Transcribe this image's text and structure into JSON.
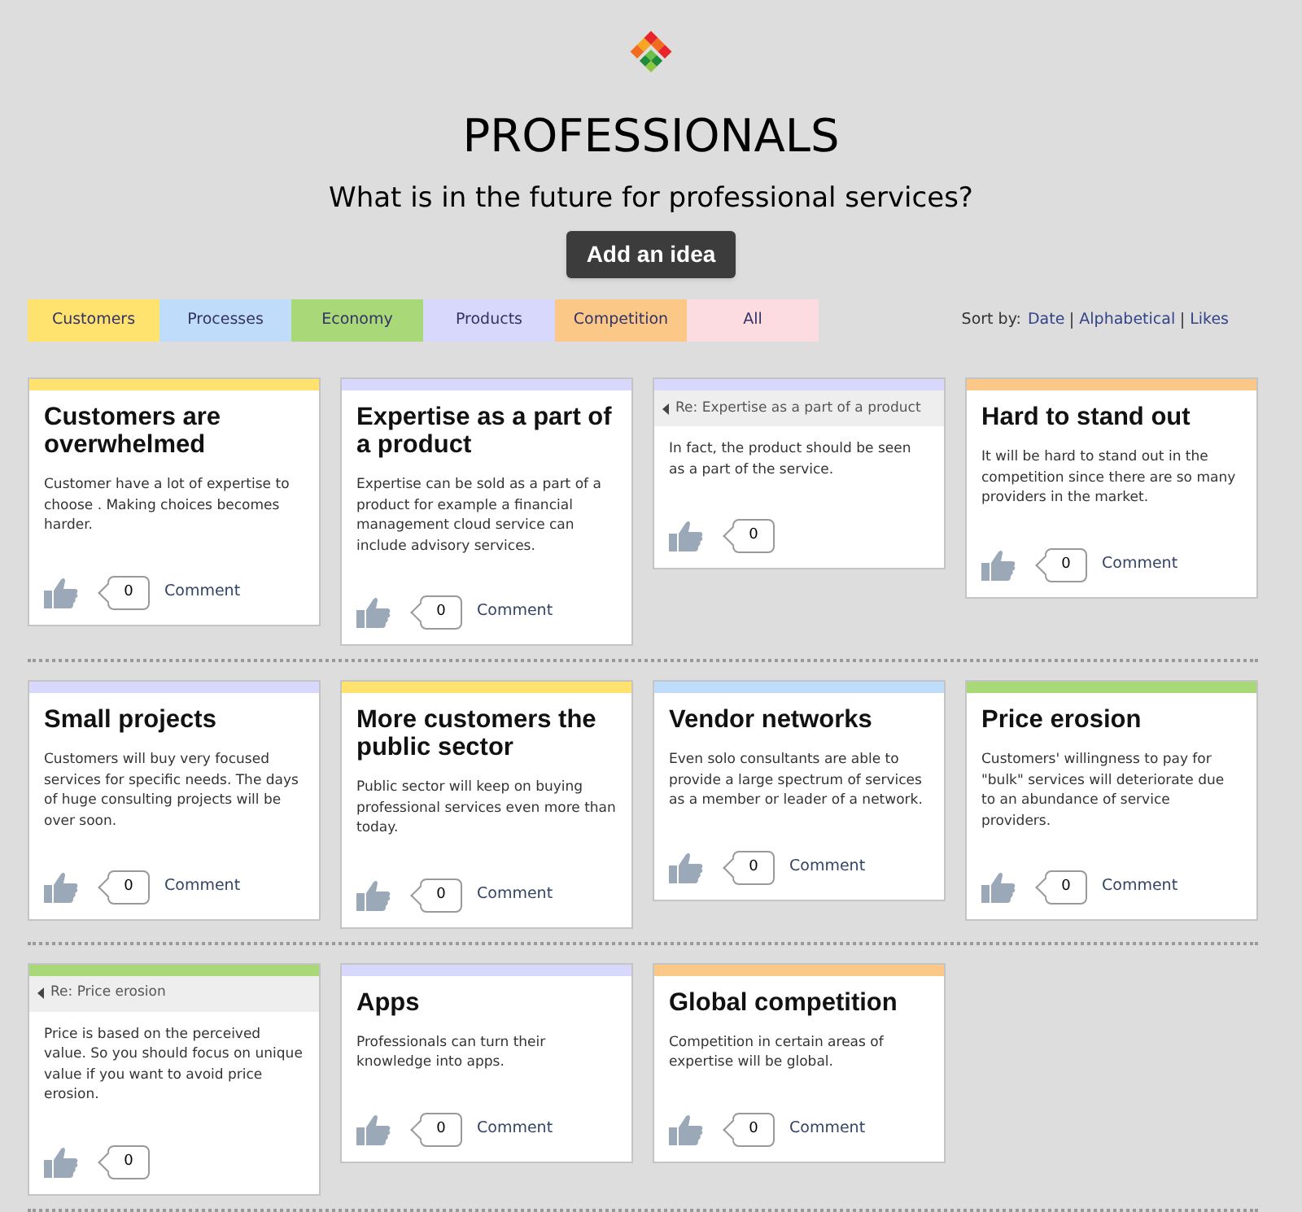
{
  "title": "PROFESSIONALS",
  "question": "What is in the future for professional services?",
  "add_button": "Add an idea",
  "filters": [
    {
      "label": "Customers",
      "color": "#ffe36e"
    },
    {
      "label": "Processes",
      "color": "#bfdcfa"
    },
    {
      "label": "Economy",
      "color": "#a8d878"
    },
    {
      "label": "Products",
      "color": "#d8d8fc"
    },
    {
      "label": "Competition",
      "color": "#fcc888"
    },
    {
      "label": "All",
      "color": "#fcdce0"
    }
  ],
  "sort": {
    "label": "Sort by:",
    "options": [
      "Date",
      "Alphabetical",
      "Likes"
    ]
  },
  "rows": [
    [
      {
        "kind": "idea",
        "color": "#ffe36e",
        "title": "Customers are overwhelmed",
        "body": "Customer have a lot of expertise to choose . Making choices becomes harder.",
        "likes": "0",
        "comment": "Comment"
      },
      {
        "kind": "idea",
        "color": "#d8d8fc",
        "title": "Expertise as a part of a product",
        "body": "Expertise can be sold as a part of a product for example a financial management cloud service can include advisory services.",
        "likes": "0",
        "comment": "Comment"
      },
      {
        "kind": "reply",
        "color": "#d8d8fc",
        "reply_to": "Re: Expertise as a part of a product",
        "body": "In fact, the product should be seen as a part of the service.",
        "likes": "0"
      },
      {
        "kind": "idea",
        "color": "#fcc888",
        "title": "Hard to stand out",
        "body": "It will be hard to stand out in the competition since there are so many providers in the market.",
        "likes": "0",
        "comment": "Comment"
      }
    ],
    [
      {
        "kind": "idea",
        "color": "#d8d8fc",
        "title": "Small projects",
        "body": "Customers will buy very focused services for specific needs. The days of huge consulting projects will be over soon.",
        "likes": "0",
        "comment": "Comment"
      },
      {
        "kind": "idea",
        "color": "#ffe36e",
        "title": "More customers the public sector",
        "body": "Public sector will keep on buying professional services even more than today.",
        "likes": "0",
        "comment": "Comment"
      },
      {
        "kind": "idea",
        "color": "#bfdcfa",
        "title": "Vendor networks",
        "body": "Even solo consultants are able to provide a large spectrum of services as a member or leader of a network.",
        "likes": "0",
        "comment": "Comment"
      },
      {
        "kind": "idea",
        "color": "#a8d878",
        "title": "Price erosion",
        "body": "Customers' willingness to pay for \"bulk\" services will deteriorate due to an abundance of service providers.",
        "likes": "0",
        "comment": "Comment"
      }
    ],
    [
      {
        "kind": "reply",
        "color": "#a8d878",
        "reply_to": "Re: Price erosion",
        "body": "Price is based on the perceived value. So you should focus on unique value if you want to avoid price erosion.",
        "likes": "0"
      },
      {
        "kind": "idea",
        "color": "#d8d8fc",
        "title": "Apps",
        "body": "Professionals can turn their knowledge into apps.",
        "likes": "0",
        "comment": "Comment"
      },
      {
        "kind": "idea",
        "color": "#fcc888",
        "title": "Global competition",
        "body": "Competition in certain areas of expertise will be global.",
        "likes": "0",
        "comment": "Comment"
      }
    ]
  ]
}
